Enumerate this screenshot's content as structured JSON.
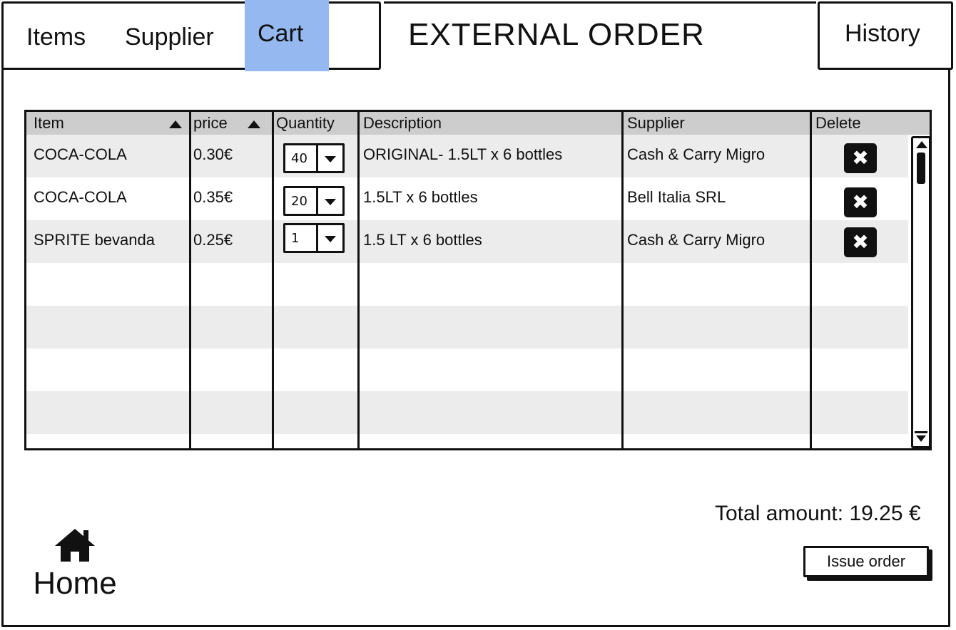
{
  "nav": {
    "items": [
      {
        "label": "Items"
      },
      {
        "label": "Supplier"
      },
      {
        "label": "Cart"
      }
    ],
    "title": "EXTERNAL ORDER",
    "history": "History"
  },
  "table": {
    "columns": [
      "Item",
      "price",
      "Quantity",
      "Description",
      "Supplier",
      "Delete"
    ],
    "rows": [
      {
        "item": "COCA-COLA",
        "price": "0.30€",
        "quantity": "40",
        "description": "ORIGINAL- 1.5LT x 6 bottles",
        "supplier": "Cash & Carry Migro"
      },
      {
        "item": "COCA-COLA",
        "price": "0.35€",
        "quantity": "20",
        "description": "1.5LT x 6 bottles",
        "supplier": "Bell Italia SRL"
      },
      {
        "item": "SPRITE bevanda",
        "price": "0.25€",
        "quantity": "1",
        "description": "1.5 LT x 6 bottles",
        "supplier": "Cash & Carry Migro"
      }
    ]
  },
  "footer": {
    "total": "Total amount: 19.25 €",
    "issue_order": "Issue order",
    "home": "Home"
  },
  "colors": {
    "active_tab": "#94b8ef",
    "header_bg": "#cdcdcd",
    "row_alt": "#ececec"
  },
  "icons": {
    "sort": "sort-up-icon",
    "delete": "close-icon",
    "home": "home-icon",
    "dropdown": "chevron-down-icon"
  }
}
